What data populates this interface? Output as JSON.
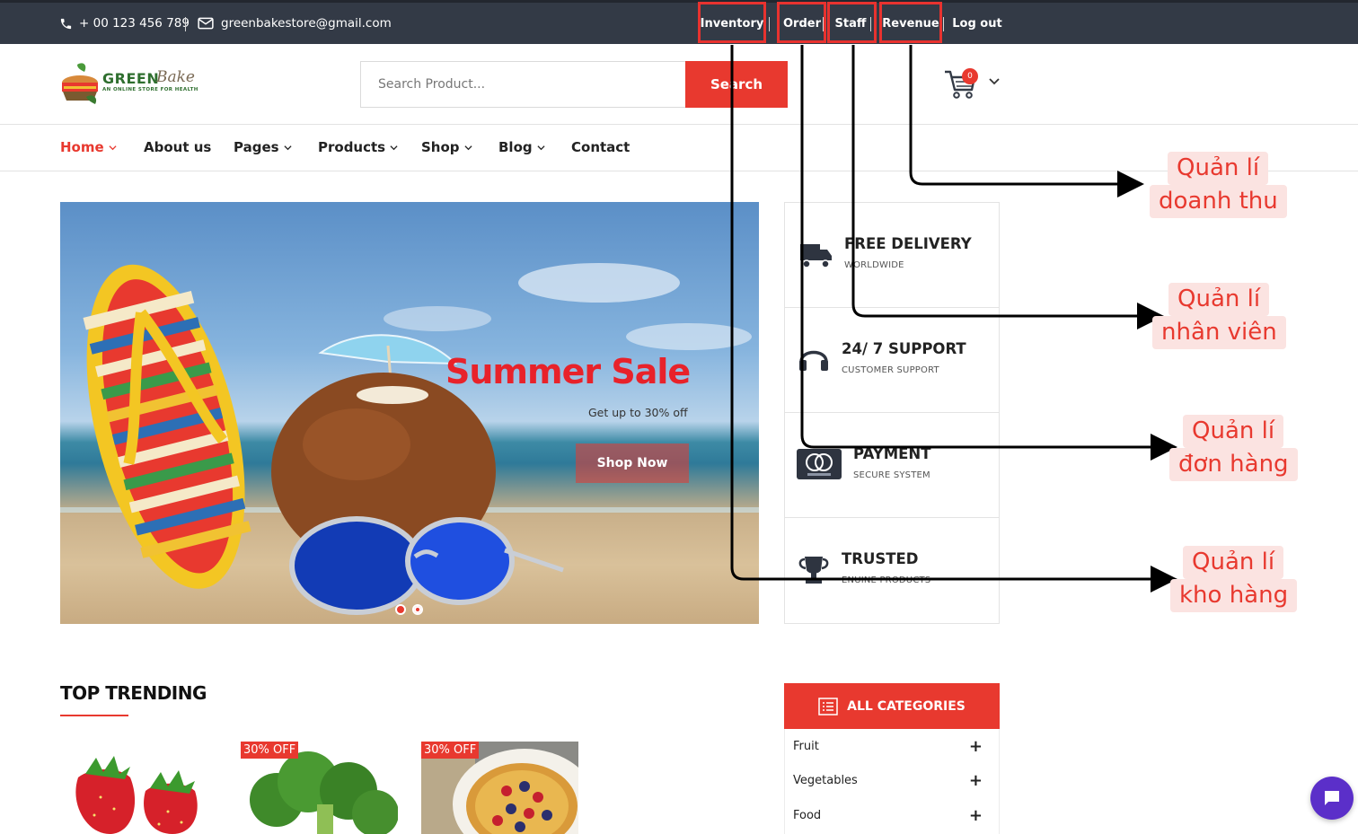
{
  "topbar": {
    "phone": "+ 00 123 456 789",
    "email": "greenbakestore@gmail.com",
    "links": {
      "inventory": "Inventory",
      "order": "Order",
      "staff": "Staff",
      "revenue": "Revenue",
      "logout": "Log out"
    },
    "highlight_color": "#e8322f"
  },
  "logo": {
    "word": "GREEN",
    "script": "Bake",
    "tagline": "AN ONLINE STORE FOR HEALTH"
  },
  "search": {
    "placeholder": "Search Product...",
    "button": "Search"
  },
  "cart": {
    "count": "0"
  },
  "nav": {
    "home": "Home",
    "about": "About us",
    "pages": "Pages",
    "products": "Products",
    "shop": "Shop",
    "blog": "Blog",
    "contact": "Contact"
  },
  "hero": {
    "title": "Summer Sale",
    "subtitle": "Get up to 30% off",
    "button": "Shop Now",
    "slide_count": 2,
    "active_slide": 1
  },
  "features": [
    {
      "title": "FREE DELIVERY",
      "subtitle": "WORLDWIDE",
      "icon": "truck-icon"
    },
    {
      "title": "24/ 7 SUPPORT",
      "subtitle": "CUSTOMER SUPPORT",
      "icon": "headset-icon"
    },
    {
      "title": "PAYMENT",
      "subtitle": "SECURE SYSTEM",
      "icon": "mastercard-icon"
    },
    {
      "title": "TRUSTED",
      "subtitle": "ENUINE PRODUCTS",
      "icon": "trophy-icon"
    }
  ],
  "trending": {
    "title": "TOP TRENDING",
    "products": [
      {
        "badge": "",
        "image": "strawberry"
      },
      {
        "badge": "30% OFF",
        "image": "broccoli"
      },
      {
        "badge": "30% OFF",
        "image": "fruit-tart"
      }
    ]
  },
  "categories": {
    "title": "ALL CATEGORIES",
    "items": [
      "Fruit",
      "Vegetables",
      "Food"
    ]
  },
  "annotations": {
    "revenue": [
      "Quản lí",
      "doanh thu"
    ],
    "staff": [
      "Quản lí",
      "nhân viên"
    ],
    "order": [
      "Quản lí",
      "đơn hàng"
    ],
    "inventory": [
      "Quản lí",
      "kho hàng"
    ]
  },
  "colors": {
    "accent": "#e8392f",
    "topbar": "#333a46",
    "chat": "#5b2fc9"
  }
}
